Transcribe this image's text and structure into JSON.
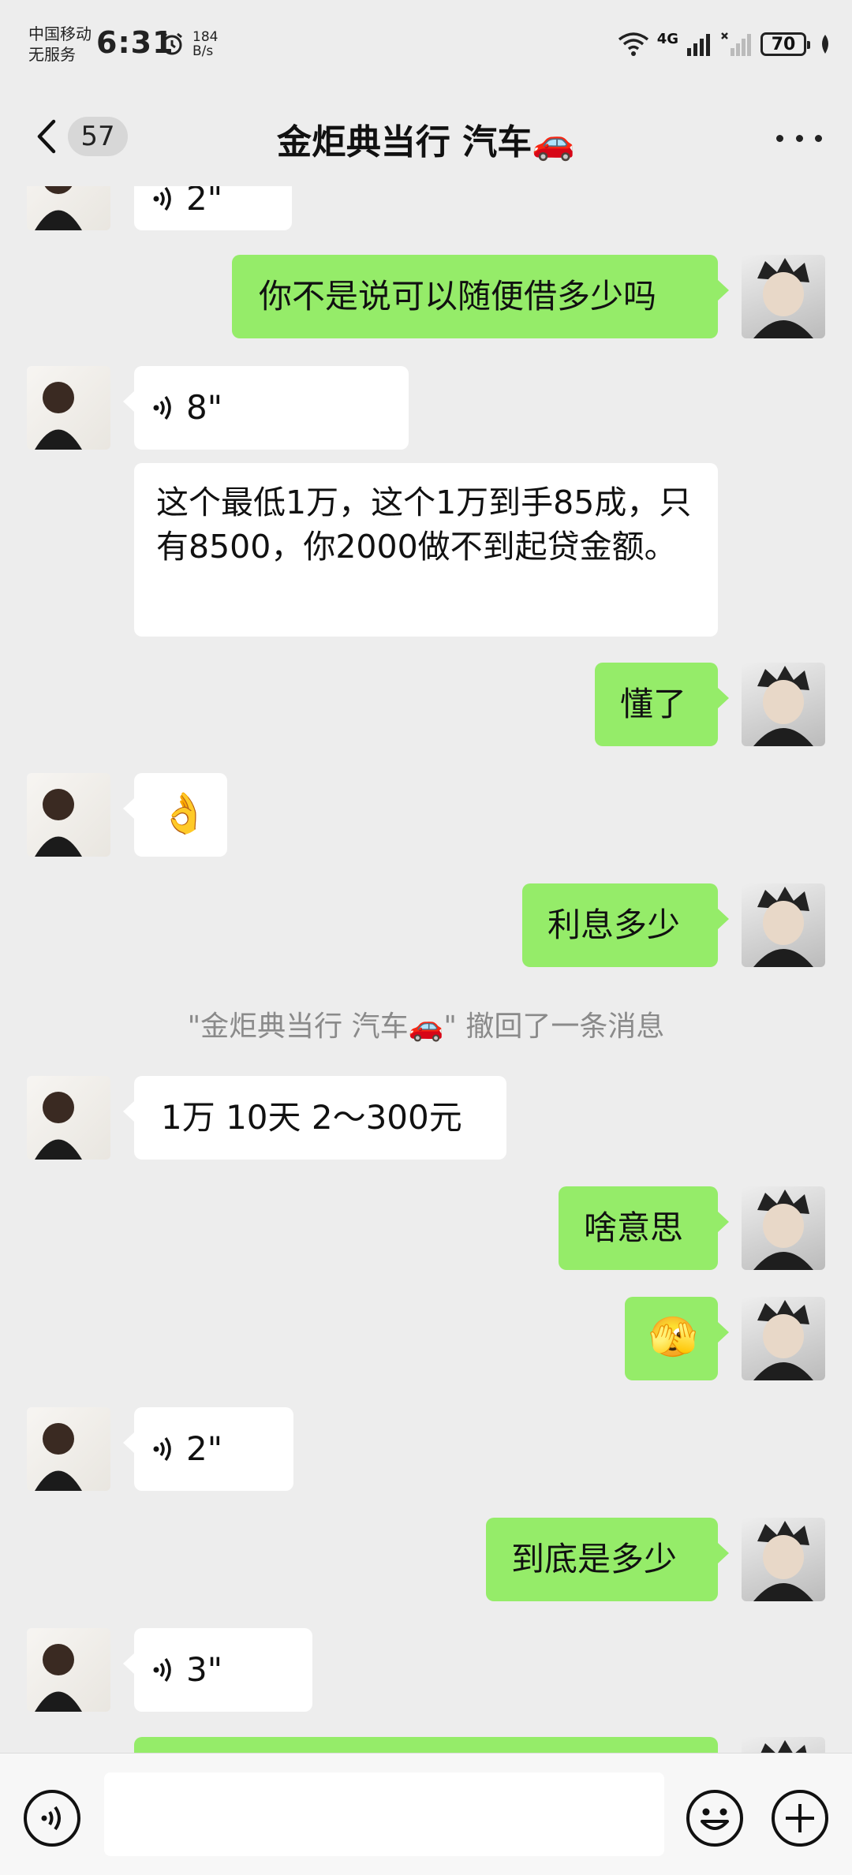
{
  "status": {
    "carrier1": "中国移动",
    "carrier2": "无服务",
    "time": "6:31",
    "speed_value": "184",
    "speed_unit": "B/s",
    "network": "4G",
    "battery": "70"
  },
  "nav": {
    "unread_count": "57",
    "title": "金炬典当行 汽车🚗"
  },
  "messages": {
    "m0": "2\"",
    "m1": "你不是说可以随便借多少吗",
    "m2": "8\"",
    "m3": "这个最低1万，这个1万到手85成，只有8500，你2000做不到起贷金额。",
    "m4": "懂了",
    "m5": "👌",
    "m6": "利息多少",
    "m7": "\"金炬典当行 汽车🚗\" 撤回了一条消息",
    "m8": "1万 10天 2～300元",
    "m9": "啥意思",
    "m10": "🫣",
    "m11": "2\"",
    "m12": "到底是多少",
    "m13": "3\""
  },
  "colors": {
    "outgoing_bubble": "#95ec69",
    "incoming_bubble": "#ffffff",
    "chat_background": "#ededed"
  },
  "icons": [
    "back-arrow-icon",
    "more-icon",
    "voice-wave-icon",
    "voice-toggle-icon",
    "emoji-icon",
    "plus-icon",
    "alarm-icon",
    "wifi-icon",
    "signal-icon"
  ]
}
